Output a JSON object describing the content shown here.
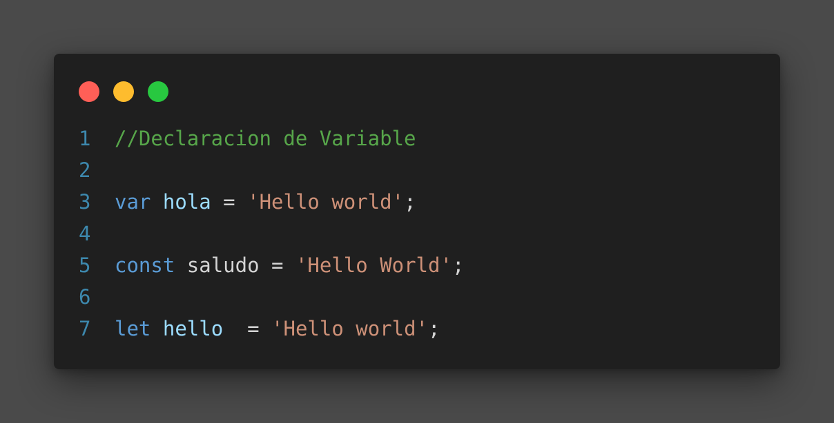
{
  "window": {
    "dots": [
      {
        "name": "close",
        "color": "#ff5f57"
      },
      {
        "name": "minimize",
        "color": "#febc2e"
      },
      {
        "name": "maximize",
        "color": "#28c840"
      }
    ]
  },
  "code": {
    "lines": [
      {
        "num": "1",
        "comment": "//Declaracion de Variable"
      },
      {
        "num": "2"
      },
      {
        "num": "3",
        "kw": "var",
        "ident": "hola",
        "eq": "=",
        "str": "'Hello world'",
        "end": ";"
      },
      {
        "num": "4"
      },
      {
        "num": "5",
        "kw": "const",
        "ident": "saludo",
        "eq": "=",
        "str": "'Hello World'",
        "end": ";"
      },
      {
        "num": "6"
      },
      {
        "num": "7",
        "kw": "let",
        "ident": "hello",
        "eq": "=",
        "str": "'Hello world'",
        "end": ";"
      }
    ]
  }
}
